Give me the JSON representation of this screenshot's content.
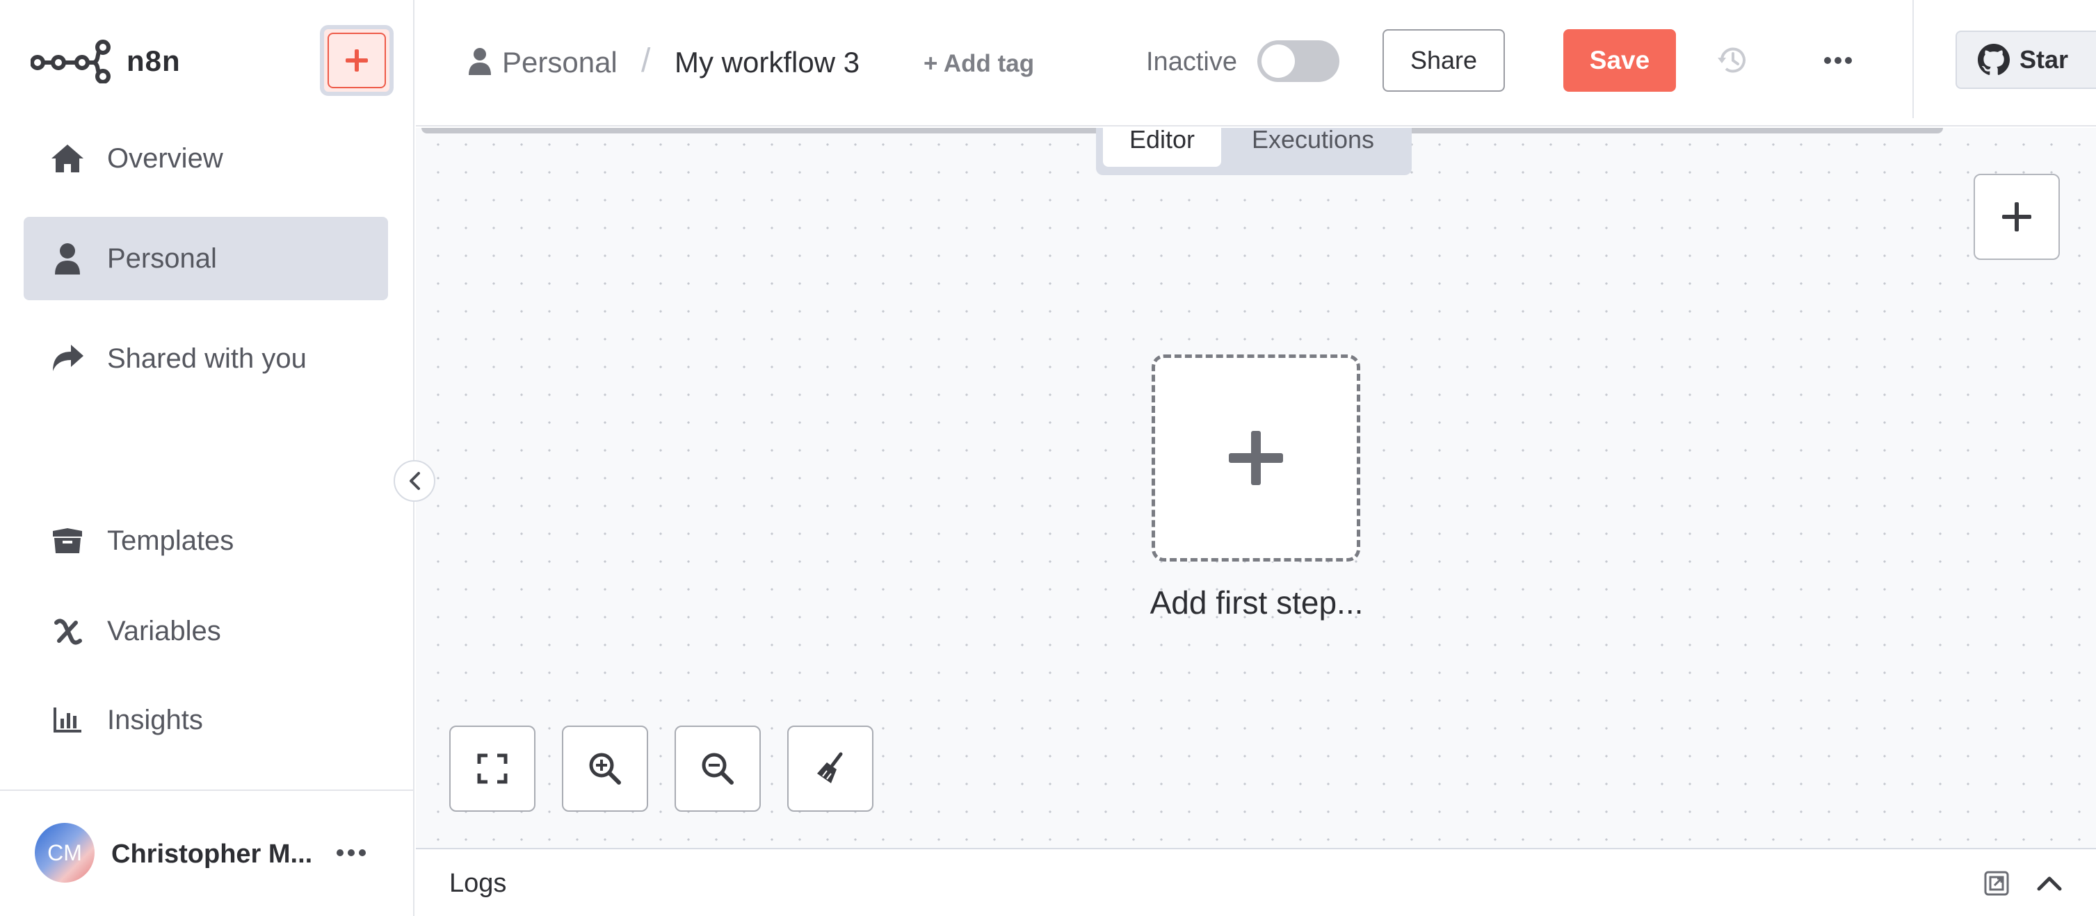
{
  "app": {
    "logo_text": "n8n"
  },
  "sidebar": {
    "new_button_icon": "plus-icon",
    "items": [
      {
        "label": "Overview",
        "icon": "home-icon"
      },
      {
        "label": "Personal",
        "icon": "user-icon",
        "active": true
      },
      {
        "label": "Shared with you",
        "icon": "share-arrow-icon"
      },
      {
        "label": "Templates",
        "icon": "box-icon"
      },
      {
        "label": "Variables",
        "icon": "variable-icon"
      },
      {
        "label": "Insights",
        "icon": "bar-chart-icon"
      }
    ],
    "user": {
      "initials": "CM",
      "name": "Christopher M..."
    }
  },
  "header": {
    "project": "Personal",
    "separator": "/",
    "workflow_title": "My workflow 3",
    "add_tag": "+ Add tag",
    "status_label": "Inactive",
    "active": false,
    "share_label": "Share",
    "save_label": "Save",
    "star_label": "Star"
  },
  "tabs": {
    "editor": "Editor",
    "executions": "Executions",
    "selected": "Editor"
  },
  "canvas": {
    "first_step_label": "Add first step..."
  },
  "logs": {
    "label": "Logs"
  },
  "colors": {
    "accent": "#f66a5a",
    "sidebar_active": "#dcdfe8",
    "canvas_bg": "#f8f9fb"
  }
}
